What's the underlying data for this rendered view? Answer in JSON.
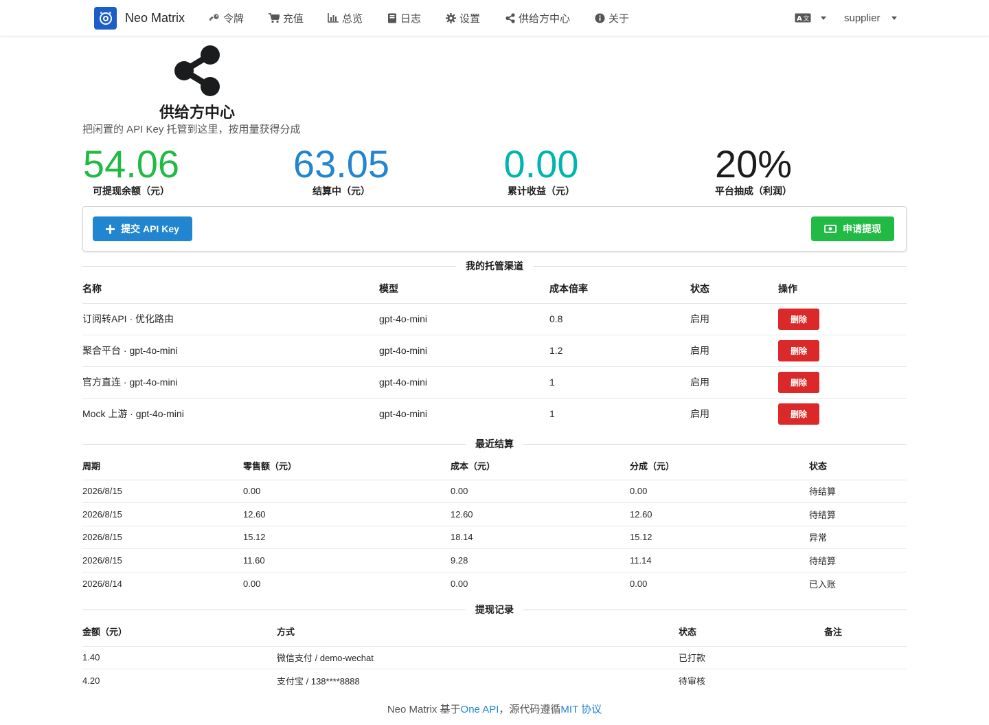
{
  "app": {
    "name": "Neo Matrix"
  },
  "nav": {
    "items": [
      {
        "label": "令牌",
        "icon": "key-icon"
      },
      {
        "label": "充值",
        "icon": "cart-icon"
      },
      {
        "label": "总览",
        "icon": "bar-chart-icon"
      },
      {
        "label": "日志",
        "icon": "book-icon"
      },
      {
        "label": "设置",
        "icon": "gear-icon"
      },
      {
        "label": "供给方中心",
        "icon": "share-icon"
      },
      {
        "label": "关于",
        "icon": "info-icon"
      }
    ],
    "language_icon": "translate-icon",
    "user": "supplier"
  },
  "header": {
    "icon": "share-alternate-icon",
    "title": "供给方中心",
    "subtitle": "把闲置的 API Key 托管到这里，按用量获得分成"
  },
  "stats": [
    {
      "value": "54.06",
      "label": "可提现余额（元）",
      "color": "#21ba45"
    },
    {
      "value": "63.05",
      "label": "结算中（元）",
      "color": "#2185d0"
    },
    {
      "value": "0.00",
      "label": "累计收益（元）",
      "color": "#00b5ad"
    },
    {
      "value": "20%",
      "label": "平台抽成（利润）",
      "color": "#1b1c1d"
    }
  ],
  "actions": {
    "submit_key": "提交 API Key",
    "withdraw": "申请提现"
  },
  "channels": {
    "title": "我的托管渠道",
    "columns": [
      "名称",
      "模型",
      "成本倍率",
      "状态",
      "操作"
    ],
    "rows": [
      {
        "name": "订阅转API · 优化路由",
        "model": "gpt-4o-mini",
        "ratio": "0.8",
        "status": "启用",
        "action": "删除"
      },
      {
        "name": "聚合平台 · gpt-4o-mini",
        "model": "gpt-4o-mini",
        "ratio": "1.2",
        "status": "启用",
        "action": "删除"
      },
      {
        "name": "官方直连 · gpt-4o-mini",
        "model": "gpt-4o-mini",
        "ratio": "1",
        "status": "启用",
        "action": "删除"
      },
      {
        "name": "Mock 上游 · gpt-4o-mini",
        "model": "gpt-4o-mini",
        "ratio": "1",
        "status": "启用",
        "action": "删除"
      }
    ]
  },
  "settlements": {
    "title": "最近结算",
    "columns": [
      "周期",
      "零售额（元）",
      "成本（元）",
      "分成（元）",
      "状态"
    ],
    "rows": [
      {
        "period": "2026/8/15",
        "retail": "0.00",
        "cost": "0.00",
        "share": "0.00",
        "status": "待结算"
      },
      {
        "period": "2026/8/15",
        "retail": "12.60",
        "cost": "12.60",
        "share": "12.60",
        "status": "待结算"
      },
      {
        "period": "2026/8/15",
        "retail": "15.12",
        "cost": "18.14",
        "share": "15.12",
        "status": "异常"
      },
      {
        "period": "2026/8/15",
        "retail": "11.60",
        "cost": "9.28",
        "share": "11.14",
        "status": "待结算"
      },
      {
        "period": "2026/8/14",
        "retail": "0.00",
        "cost": "0.00",
        "share": "0.00",
        "status": "已入账"
      }
    ]
  },
  "withdrawals": {
    "title": "提现记录",
    "columns": [
      "金额（元）",
      "方式",
      "状态",
      "备注"
    ],
    "rows": [
      {
        "amount": "1.40",
        "method": "微信支付 / demo-wechat",
        "status": "已打款",
        "note": ""
      },
      {
        "amount": "4.20",
        "method": "支付宝 / 138****8888",
        "status": "待审核",
        "note": ""
      }
    ]
  },
  "footer": {
    "prefix": "Neo Matrix 基于",
    "link1": "One API",
    "middle": "，源代码遵循",
    "link2": "MIT 协议"
  }
}
